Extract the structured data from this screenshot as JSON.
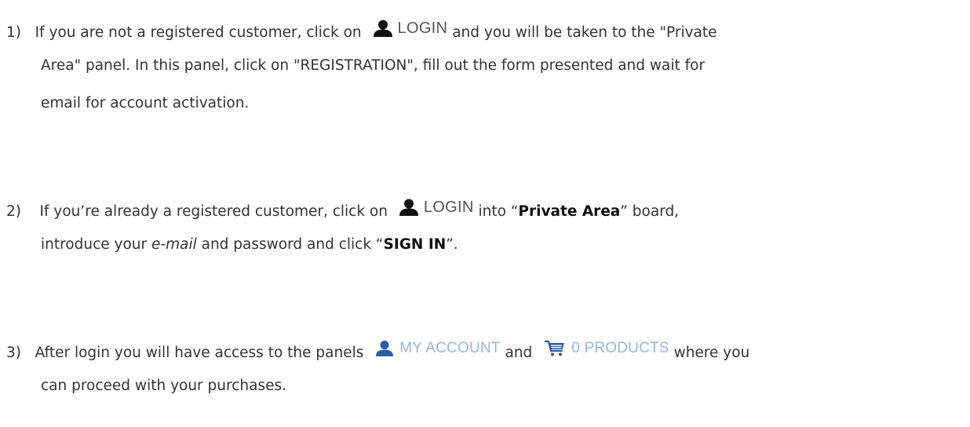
{
  "steps": [
    {
      "number": "1)",
      "text_before_login": "If you are not a registered customer, click on",
      "login_label": "LOGIN",
      "text_after_login": "and you will be taken to the \"Private",
      "line2": "Area\" panel. In this panel, click on \"REGISTRATION\", fill out the form presented and wait for",
      "line3": "email for account activation."
    },
    {
      "number": "2)",
      "text_before_login": "If you’re already a registered customer, click on",
      "login_label": "LOGIN",
      "text_into": "into “",
      "private_area": "Private Area",
      "text_board": "” board,",
      "line2_pre": "introduce your ",
      "line2_email": "e-mail",
      "line2_mid": " and password and click “",
      "sign_in": "SIGN IN",
      "line2_end": "”."
    },
    {
      "number": "3)",
      "text_before": "After login you will have access to the panels",
      "my_account_label": "MY ACCOUNT",
      "text_and": "and",
      "products_label": "0 PRODUCTS",
      "text_after": "where you",
      "line2": "can proceed with your purchases."
    }
  ],
  "icons": {
    "login_user": "user-icon",
    "my_account_user": "user-icon",
    "products_cart": "cart-icon"
  },
  "colors": {
    "text": "#333333",
    "icon_dark": "#111111",
    "icon_blue": "#2a5ba8",
    "label_light_blue": "#9bb5dd"
  }
}
